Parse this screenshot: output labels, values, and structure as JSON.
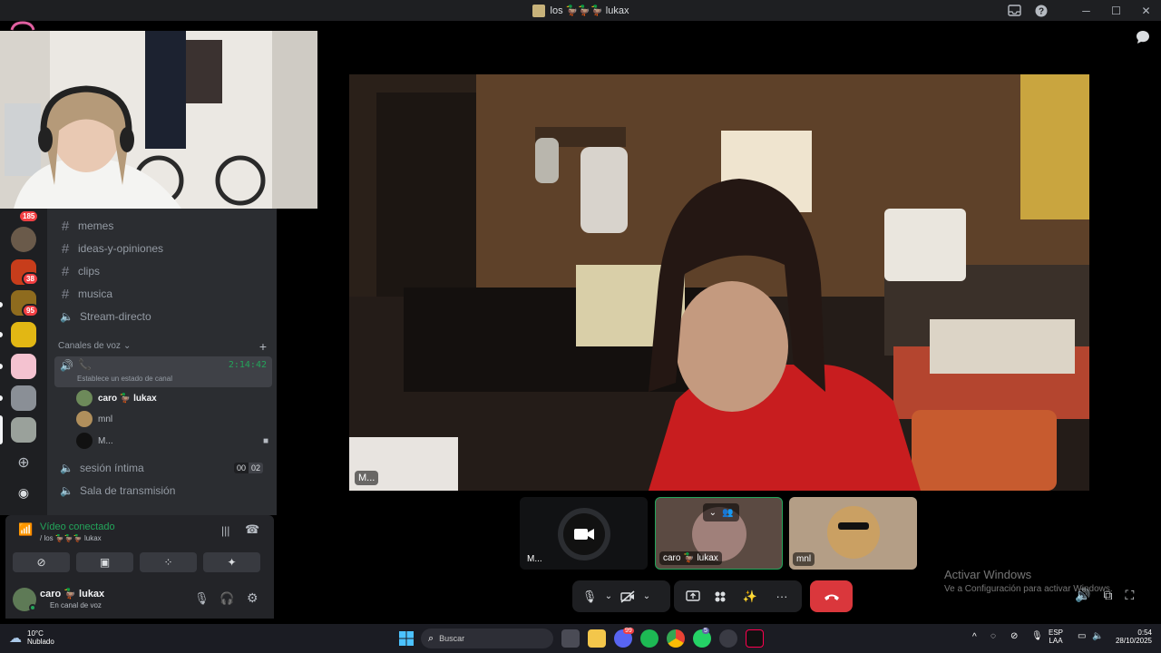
{
  "window": {
    "title": "los 🦆🦆🦆 lukax"
  },
  "servers": {
    "badges": [
      "185",
      "38",
      "95"
    ]
  },
  "channels": {
    "text": [
      {
        "name": "memes"
      },
      {
        "name": "ideas-y-opiniones"
      },
      {
        "name": "clips"
      },
      {
        "name": "musica"
      }
    ],
    "stream": {
      "name": "Stream-directo"
    },
    "voice_category": "Canales de voz",
    "active_voice": {
      "timer": "2:14:42",
      "status_hint": "Establece un estado de canal"
    },
    "members": [
      {
        "name": "caro 🦆 lukax",
        "color": "#f2f3f5",
        "bold": true
      },
      {
        "name": "mnl",
        "color": "#949ba4",
        "bold": false
      },
      {
        "name": "M...",
        "color": "#949ba4",
        "bold": false
      }
    ],
    "other_voice": [
      {
        "name": "sesión íntima",
        "count_a": "00",
        "count_b": "02"
      },
      {
        "name": "Sala de transmisión"
      }
    ]
  },
  "voice_status": {
    "title": "Vídeo conectado",
    "subtitle": "/ los 🦆🦆🦆 lukax",
    "color": "#23a55a"
  },
  "user": {
    "name": "caro 🦆 lukax",
    "status": "En canal de voz"
  },
  "call": {
    "main_label": "M...",
    "tiles": [
      {
        "label": "M..."
      },
      {
        "label": "caro 🦆 lukax"
      },
      {
        "label": "mnl"
      }
    ]
  },
  "watermark": {
    "line1": "Activar Windows",
    "line2": "Ve a Configuración para activar Windows."
  },
  "taskbar": {
    "weather_temp": "10°C",
    "weather_desc": "Nublado",
    "search_placeholder": "Buscar",
    "lang_top": "ESP",
    "lang_bottom": "LAA",
    "time": "0:54",
    "date": "28/10/2025",
    "badge_discord": "99",
    "badge_whatsapp": "5"
  },
  "colors": {
    "accent_green": "#23a55a",
    "hangup_red": "#da373c",
    "badge_red": "#f23f43"
  }
}
